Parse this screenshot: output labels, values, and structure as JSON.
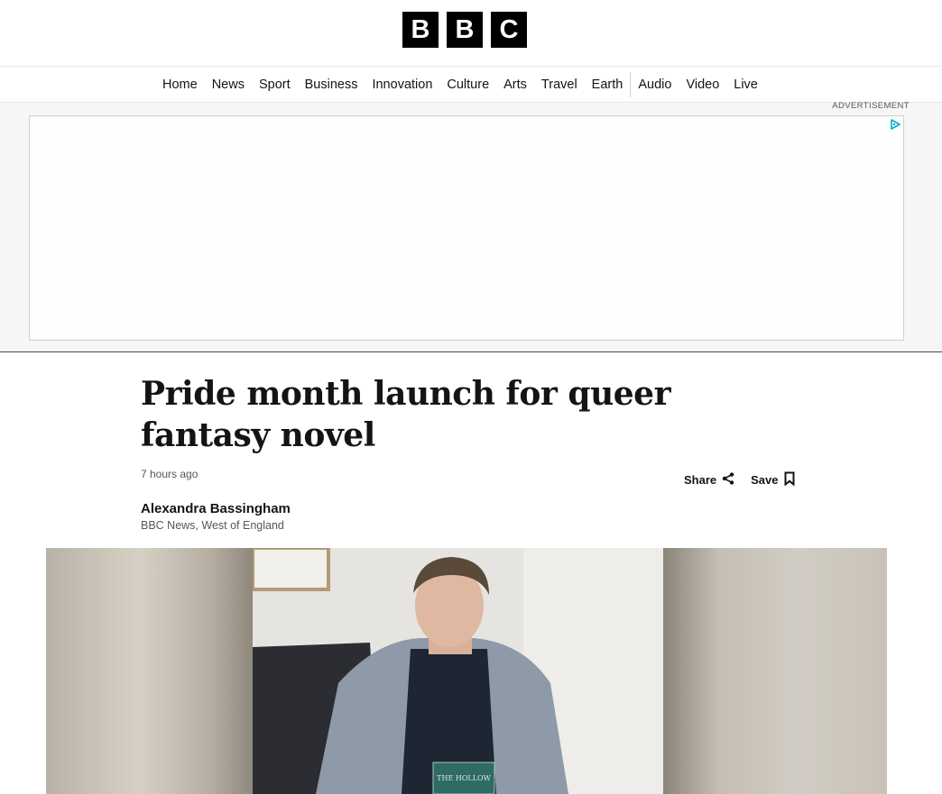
{
  "logo": {
    "letters": [
      "B",
      "B",
      "C"
    ]
  },
  "nav": {
    "items": [
      "Home",
      "News",
      "Sport",
      "Business",
      "Innovation",
      "Culture",
      "Arts",
      "Travel",
      "Earth"
    ],
    "media_items": [
      "Audio",
      "Video",
      "Live"
    ]
  },
  "ad": {
    "label": "ADVERTISEMENT",
    "choice_icon": "adchoices-icon"
  },
  "article": {
    "headline": "Pride month launch for queer fantasy novel",
    "timestamp": "7 hours ago",
    "share_label": "Share",
    "save_label": "Save",
    "author_name": "Alexandra Bassingham",
    "author_org": "BBC News, West of England",
    "hero_book_text": "THE HOLLOW"
  },
  "colors": {
    "brand_black": "#000000",
    "ad_choice_blue": "#00aecd"
  }
}
